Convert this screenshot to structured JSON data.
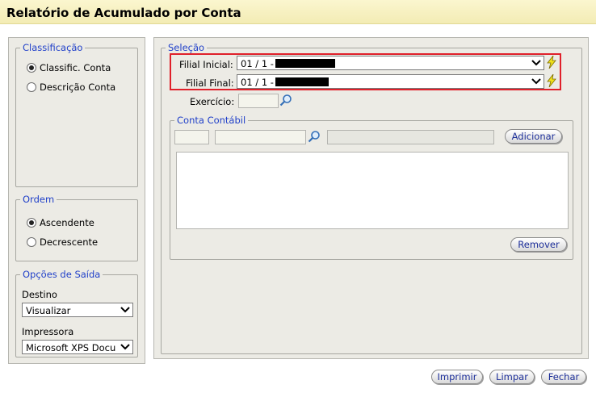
{
  "header": {
    "title": "Relatório de Acumulado por Conta"
  },
  "classificacao": {
    "legend": "Classificação",
    "options": [
      {
        "label": "Classific. Conta",
        "selected": true
      },
      {
        "label": "Descrição Conta",
        "selected": false
      }
    ]
  },
  "ordem": {
    "legend": "Ordem",
    "options": [
      {
        "label": "Ascendente",
        "selected": true
      },
      {
        "label": "Decrescente",
        "selected": false
      }
    ]
  },
  "saida": {
    "legend": "Opções de Saída",
    "destino_label": "Destino",
    "destino_value": "Visualizar",
    "impressora_label": "Impressora",
    "impressora_value": "Microsoft XPS Docu"
  },
  "selecao": {
    "legend": "Seleção",
    "filial_inicial_label": "Filial Inicial:",
    "filial_inicial_value": "01 / 1 -",
    "filial_final_label": "Filial Final:",
    "filial_final_value": "01 / 1 -",
    "exercicio_label": "Exercício:",
    "exercicio_value": ""
  },
  "conta_contabil": {
    "legend": "Conta Contábil",
    "adicionar_label": "Adicionar",
    "remover_label": "Remover",
    "items": []
  },
  "footer": {
    "imprimir_label": "Imprimir",
    "limpar_label": "Limpar",
    "fechar_label": "Fechar"
  },
  "icons": {
    "search": "magnifier-icon",
    "lightning": "lightning-icon",
    "dropdown": "chevron-down-icon"
  },
  "colors": {
    "header_bg": "#f3ecb4",
    "legend_text": "#1f3fc9",
    "highlight": "#e0202a",
    "panel_bg": "#ecebe5"
  }
}
